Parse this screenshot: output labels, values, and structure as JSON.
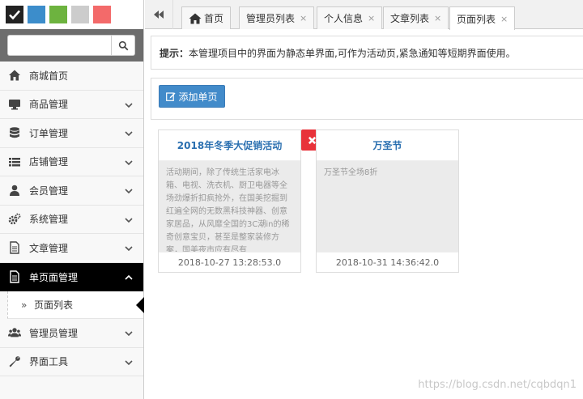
{
  "theme": {
    "swatches": [
      "#222222",
      "#3c8dcb",
      "#6db33f",
      "#cccccc",
      "#f36a6a"
    ],
    "accent": "#428bca",
    "danger": "#e8323a"
  },
  "search": {
    "value": "",
    "placeholder": ""
  },
  "sidebar": {
    "items": [
      {
        "label": "商城首页",
        "icon": "home-icon",
        "expandable": false
      },
      {
        "label": "商品管理",
        "icon": "desktop-icon",
        "expandable": true
      },
      {
        "label": "订单管理",
        "icon": "database-icon",
        "expandable": true
      },
      {
        "label": "店铺管理",
        "icon": "list-icon",
        "expandable": true
      },
      {
        "label": "会员管理",
        "icon": "user-icon",
        "expandable": true
      },
      {
        "label": "系统管理",
        "icon": "gears-icon",
        "expandable": true
      },
      {
        "label": "文章管理",
        "icon": "file-icon",
        "expandable": true
      },
      {
        "label": "单页面管理",
        "icon": "document-icon",
        "expandable": true,
        "active": true
      },
      {
        "label": "管理员管理",
        "icon": "users-icon",
        "expandable": true
      },
      {
        "label": "界面工具",
        "icon": "wrench-icon",
        "expandable": true
      }
    ],
    "sub_items": [
      {
        "prefix": "»",
        "label": "页面列表"
      }
    ]
  },
  "tabs": [
    {
      "label": "首页",
      "icon": "home-icon",
      "closable": false
    },
    {
      "label": "管理员列表",
      "closable": true,
      "close": "×"
    },
    {
      "label": "个人信息",
      "closable": true,
      "close": "×"
    },
    {
      "label": "文章列表",
      "closable": true,
      "close": "×"
    },
    {
      "label": "页面列表",
      "closable": true,
      "close": "×",
      "active": true
    }
  ],
  "notice": {
    "label": "提示：",
    "text": "本管理项目中的界面为静态单界面,可作为活动页,紧急通知等短期界面使用。"
  },
  "toolbar": {
    "add_label": "添加单页"
  },
  "cards": [
    {
      "title": "2018年冬季大促销活动",
      "body": "活动期间，除了传统生活家电冰箱、电视、洗衣机、厨卫电器等全场劲爆折扣疯抢外，在国美挖掘到红遍全网的无数黑科技神器、创意家居品，从风靡全国的3C潮in的稀奇创意宝贝，甚至是整家装修方案，国美夜市应有尽有",
      "date": "2018-10-27 13:28:53.0"
    },
    {
      "title": "万圣节",
      "body": "万圣节全场8折",
      "date": "2018-10-31 14:36:42.0"
    }
  ],
  "watermark": "https://blog.csdn.net/cqbdqn1"
}
